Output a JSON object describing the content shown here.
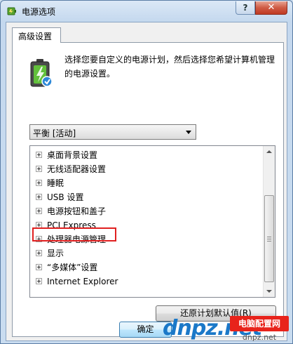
{
  "window": {
    "title": "电源选项",
    "help_label": "?",
    "close_label": "✕"
  },
  "tab": {
    "label": "高级设置"
  },
  "description": "选择您要自定义的电源计划，然后选择您希望计算机管理的电源设置。",
  "plan": {
    "selected": "平衡 [活动]"
  },
  "settings": [
    "桌面背景设置",
    "无线适配器设置",
    "睡眠",
    "USB 设置",
    "电源按钮和盖子",
    "PCI Express",
    "处理器电源管理",
    "显示",
    "“多媒体”设置",
    "Internet Explorer"
  ],
  "highlighted_setting": "处理器电源管理",
  "buttons": {
    "restore_defaults": "还原计划默认值(R)",
    "ok": "确定"
  },
  "watermark": {
    "logo": "dnpz.net",
    "badge": "电脑配置网",
    "url": "dnpz.net"
  },
  "colors": {
    "highlight_border": "#e02020",
    "watermark_blue": "#1a78c8",
    "watermark_red": "#e8231b"
  }
}
